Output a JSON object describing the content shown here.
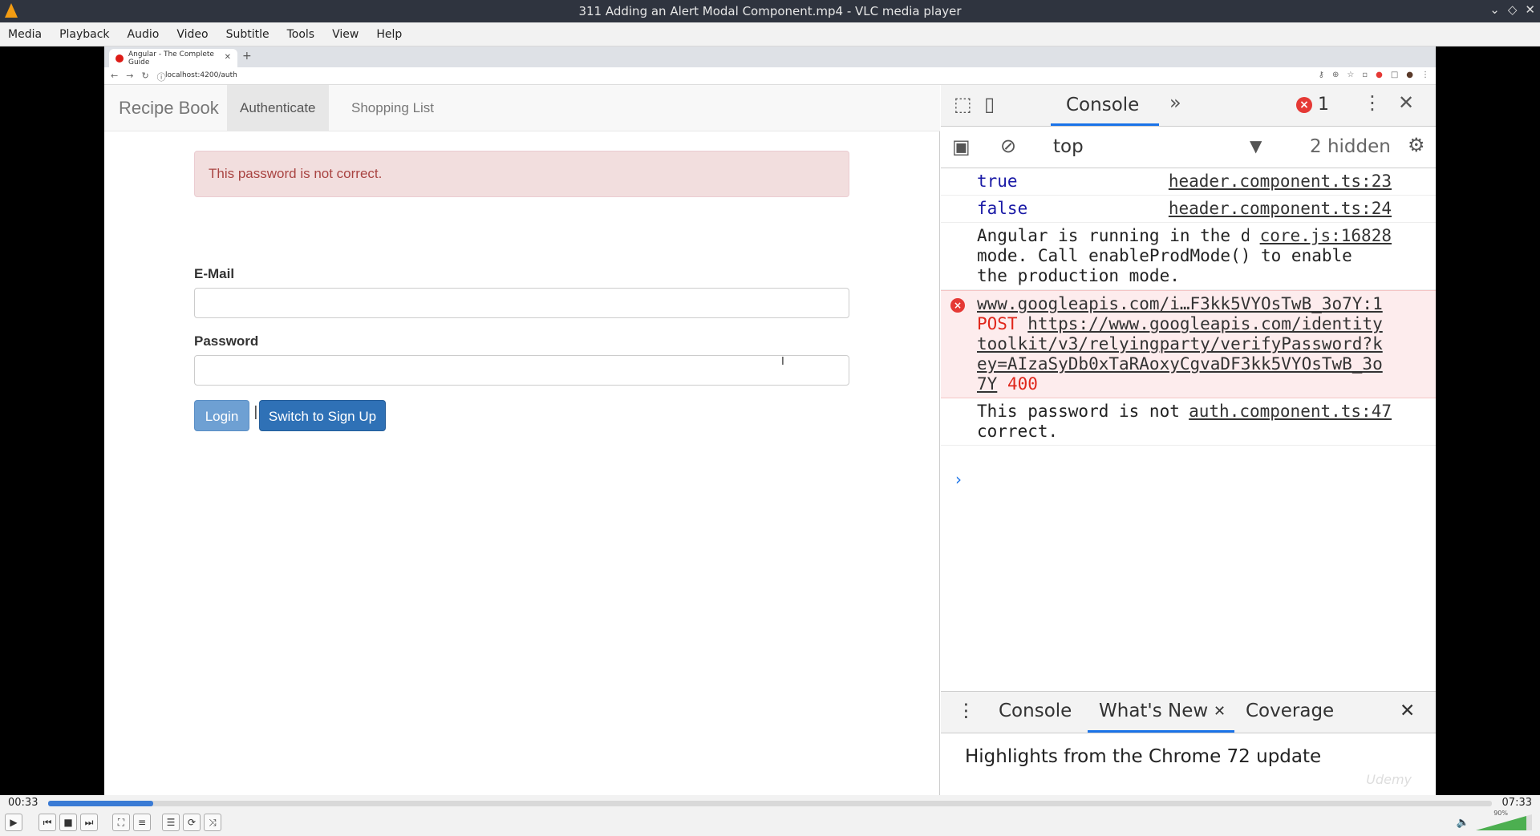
{
  "window": {
    "title": "311 Adding an Alert Modal Component.mp4 - VLC media player"
  },
  "menu": [
    "Media",
    "Playback",
    "Audio",
    "Video",
    "Subtitle",
    "Tools",
    "View",
    "Help"
  ],
  "browser": {
    "tab_title": "Angular - The Complete Guide",
    "url": "localhost:4200/auth"
  },
  "app": {
    "brand": "Recipe Book",
    "nav": [
      "Authenticate",
      "Shopping List"
    ],
    "alert": "This password is not correct.",
    "email_label": "E-Mail",
    "password_label": "Password",
    "login_button": "Login",
    "separator": "|",
    "switch_button": "Switch to Sign Up"
  },
  "devtools": {
    "tab_console": "Console",
    "error_count": "1",
    "context": "top",
    "hidden_count": "2 hidden",
    "logs": [
      {
        "text": "true",
        "source": "header.component.ts:23"
      },
      {
        "text": "false",
        "source": "header.component.ts:24"
      },
      {
        "text": "Angular is running in the development mode. Call enableProdMode() to enable the production mode.",
        "source": "core.js:16828"
      },
      {
        "source": "www.googleapis.com/i…F3kk5VYOsTwB_3o7Y:1",
        "method": "POST",
        "url": "https://www.googleapis.com/identitytoolkit/v3/relyingparty/verifyPassword?key=AIzaSyDb0xTaRAoxyCgvaDF3kk5VYOsTwB_3o7Y",
        "status": "400"
      },
      {
        "text": "This password is not correct.",
        "source": "auth.component.ts:47"
      }
    ],
    "drawer_tabs": [
      "Console",
      "What's New",
      "Coverage"
    ],
    "drawer_content": "Highlights from the Chrome 72 update",
    "watermark": "Udemy"
  },
  "player": {
    "elapsed": "00:33",
    "total": "07:33",
    "progress": 0.073,
    "volume": "90%",
    "volume_level": 0.9
  }
}
